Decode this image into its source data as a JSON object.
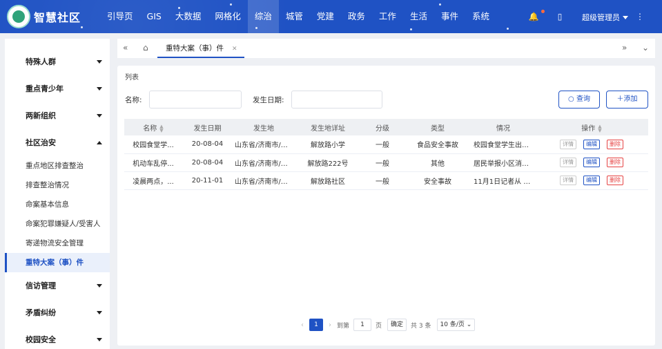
{
  "app": {
    "title": "智慧社区"
  },
  "header": {
    "nav": [
      "引导页",
      "GIS",
      "大数据",
      "网格化",
      "综治",
      "城管",
      "党建",
      "政务",
      "工作",
      "生活",
      "事件",
      "系统"
    ],
    "active_index": 4,
    "user": "超级管理员"
  },
  "sidebar": {
    "groups_top": [
      "特殊人群",
      "重点青少年",
      "两新组织"
    ],
    "open_group": "社区治安",
    "sub_items": [
      "重点地区排查整治",
      "排查整治情况",
      "命案基本信息",
      "命案犯罪嫌疑人/受害人",
      "寄递物流安全管理",
      "重特大案（事）件"
    ],
    "active_sub_index": 5,
    "groups_bottom": [
      "信访管理",
      "矛盾纠纷",
      "校园安全"
    ]
  },
  "tabs": {
    "current": "重特大案（事）件"
  },
  "main": {
    "section_title": "列表",
    "filter": {
      "name_label": "名称:",
      "date_label": "发生日期:"
    },
    "buttons": {
      "search": "查询",
      "add": "添加"
    },
    "columns": [
      "名称",
      "发生日期",
      "发生地",
      "发生地详址",
      "分级",
      "类型",
      "情况",
      "操作"
    ],
    "rows": [
      {
        "name": "校园食堂学...",
        "date": "20-08-04",
        "place": "山东省/济南市/历...",
        "address": "解放路小学",
        "level": "一般",
        "type": "食品安全事故",
        "situation": "校园食堂学生出现..."
      },
      {
        "name": "机动车乱停...",
        "date": "20-08-04",
        "place": "山东省/济南市/历...",
        "address": "解放路222号",
        "level": "一般",
        "type": "其他",
        "situation": "居民举报小区消防..."
      },
      {
        "name": "凌晨两点，...",
        "date": "20-11-01",
        "place": "山东省/济南市/历...",
        "address": "解放路社区",
        "level": "一般",
        "type": "安全事故",
        "situation": "11月1日记者从 济..."
      }
    ],
    "ops": {
      "detail": "详情",
      "edit": "编辑",
      "delete": "删除"
    }
  },
  "pager": {
    "current_page": "1",
    "goto_label": "到第",
    "goto_value": "1",
    "page_unit": "页",
    "confirm": "确定",
    "total": "共 3 条",
    "page_size": "10 条/页"
  }
}
